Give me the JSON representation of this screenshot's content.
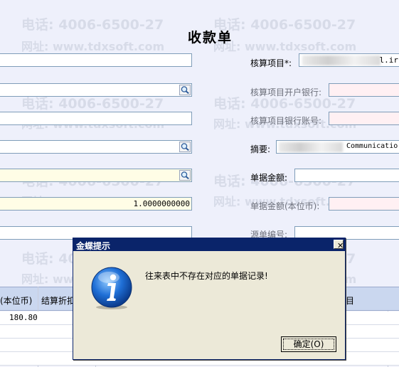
{
  "form": {
    "title": "收款单",
    "left_fields": [
      {
        "name": "field-1",
        "value": ""
      },
      {
        "name": "field-2",
        "value": ""
      },
      {
        "name": "field-3",
        "value": ""
      },
      {
        "name": "field-4",
        "value": ""
      },
      {
        "name": "field-5",
        "value": ""
      },
      {
        "name": "exchange-rate",
        "value": "1.0000000000"
      },
      {
        "name": "field-7",
        "value": ""
      }
    ],
    "right_labels": {
      "project": "核算项目*:",
      "project_bank": "核算项目开户银行:",
      "project_account": "核算项目银行账号:",
      "summary": "摘要:",
      "amount": "单据金额:",
      "amount_local": "单据金额(本位币):",
      "source_no": "源单编号:"
    },
    "right_values": {
      "project_tail": "l.ir",
      "summary_tail": "Communicatio"
    }
  },
  "watermark": {
    "phone": "电话: 4006-6500-27",
    "site": "网址: www.tdxsoft.com"
  },
  "grid": {
    "headers": [
      "(本位币)",
      "结算折扣",
      "目"
    ],
    "rows": [
      {
        "amount": "180.80"
      }
    ]
  },
  "dialog": {
    "title": "金蝶提示",
    "close": "✕",
    "message": "往来表中不存在对应的单据记录!",
    "ok_label": "确定(O)",
    "icon": "information-icon"
  }
}
